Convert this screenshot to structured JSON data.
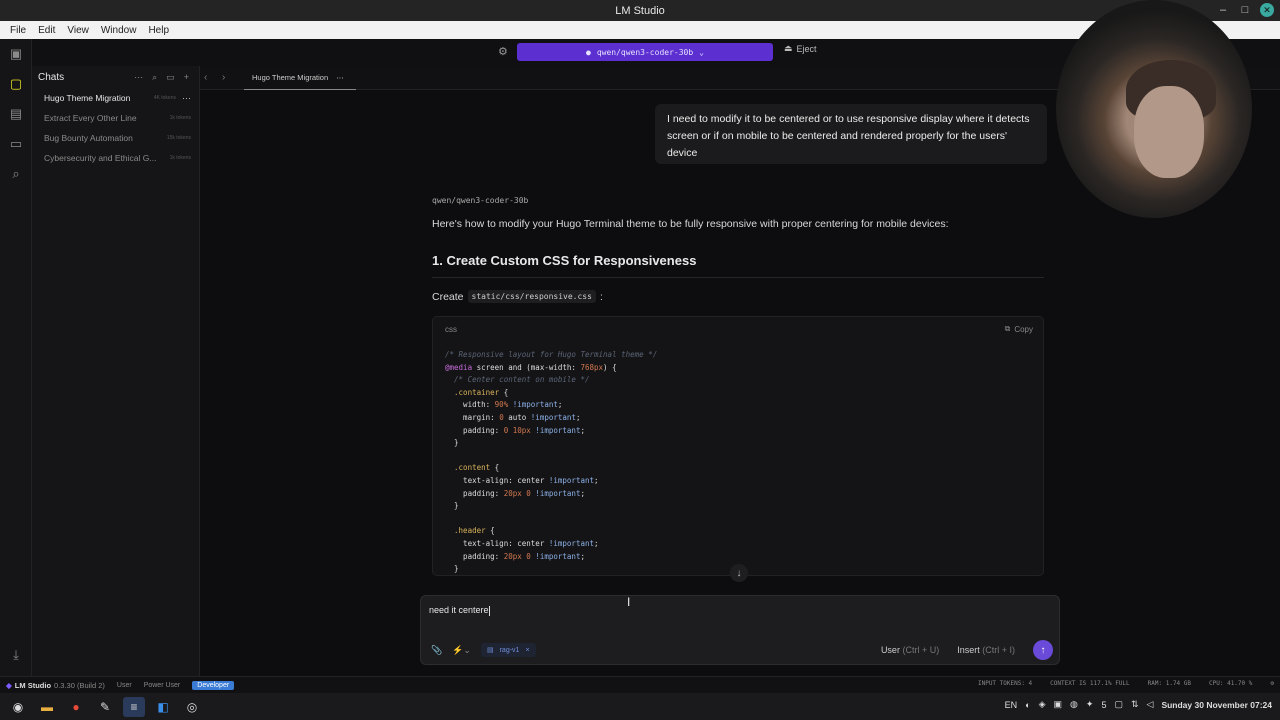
{
  "window": {
    "title": "LM Studio"
  },
  "menu": [
    "File",
    "Edit",
    "View",
    "Window",
    "Help"
  ],
  "topbar": {
    "model": "qwen/qwen3-coder-30b",
    "eject": "Eject"
  },
  "sidebar": {
    "title": "Chats",
    "items": [
      {
        "name": "Hugo Theme Migration",
        "tokens": "4K tokens"
      },
      {
        "name": "Extract Every Other Line",
        "tokens": "1k tokens"
      },
      {
        "name": "Bug Bounty Automation",
        "tokens": "15k tokens"
      },
      {
        "name": "Cybersecurity and Ethical G...",
        "tokens": "1k tokens"
      }
    ]
  },
  "tab": {
    "label": "Hugo Theme Migration"
  },
  "chat": {
    "user_message": "I need to modify it to be centered or to use responsive display where it detects screen or if on mobile to be centered and rendered properly for the users' device",
    "model_label": "qwen/qwen3-coder-30b",
    "response_intro": "Here's how to modify your Hugo Terminal theme to be fully responsive with proper centering for mobile devices:",
    "heading": "1. Create Custom CSS for Responsiveness",
    "create_prefix": "Create",
    "create_path": "static/css/responsive.css",
    "create_suffix": ":",
    "code_lang": "css",
    "copy_label": "Copy"
  },
  "composer": {
    "input_value": "need it centere",
    "rag_chip": "rag-v1",
    "user_btn": "User",
    "user_kbd": "(Ctrl + U)",
    "insert_btn": "Insert",
    "insert_kbd": "(Ctrl + I)"
  },
  "statusbar": {
    "app": "LM Studio",
    "version": "0.3.30 (Build 2)",
    "modes": [
      "User",
      "Power User",
      "Developer"
    ],
    "input_tokens": "INPUT TOKENS: 4",
    "context": "CONTEXT IS 117.1% FULL",
    "ram": "RAM: 1.74 GB",
    "cpu": "CPU: 41.70 %"
  },
  "tray": {
    "lang": "EN",
    "workspace": "5",
    "clock": "Sunday 30 November 07:24"
  }
}
